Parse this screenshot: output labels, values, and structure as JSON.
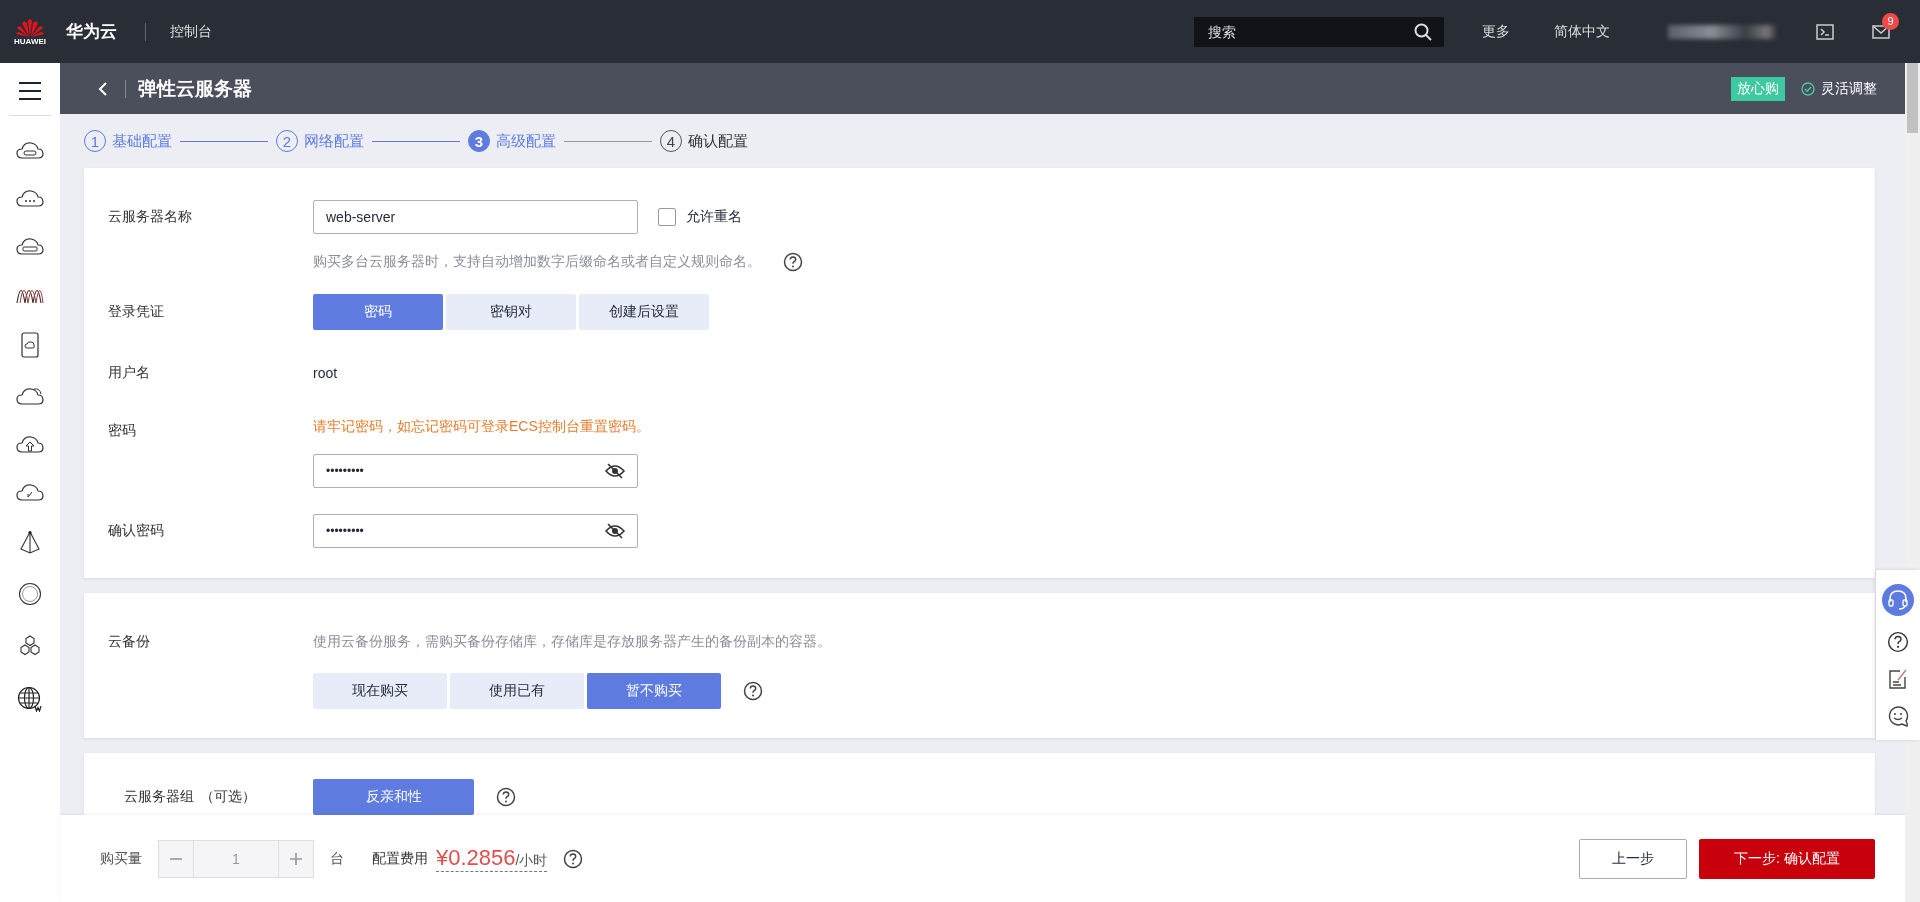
{
  "topbar": {
    "logo_text": "HUAWEI",
    "brand": "华为云",
    "console": "控制台",
    "search": {
      "placeholder": "搜索"
    },
    "links": [
      "更多",
      "简体中文"
    ],
    "notification_count": "9"
  },
  "header": {
    "title": "弹性云服务器",
    "tag": "放心购",
    "adjust": "灵活调整"
  },
  "steps": [
    {
      "number": "1",
      "label": "基础配置",
      "completed": true,
      "selected": false
    },
    {
      "number": "2",
      "label": "网络配置",
      "completed": true,
      "selected": false
    },
    {
      "number": "3",
      "label": "高级配置",
      "completed": false,
      "selected": true
    },
    {
      "number": "4",
      "label": "确认配置",
      "completed": false,
      "selected": false
    }
  ],
  "basic": {
    "name_label": "云服务器名称",
    "name_value": "web-server",
    "allow_duplicate": {
      "label": "允许重名",
      "checked": false
    },
    "name_hint": "购买多台云服务器时，支持自动增加数字后缀命名或者自定义规则命名。",
    "credential_label": "登录凭证",
    "credential_options": [
      {
        "label": "密码",
        "selected": true
      },
      {
        "label": "密钥对",
        "selected": false
      },
      {
        "label": "创建后设置",
        "selected": false
      }
    ],
    "username_label": "用户名",
    "username_value": "root",
    "password_label": "密码",
    "password_warning": "请牢记密码，如忘记密码可登录ECS控制台重置密码。",
    "password_value": "•••••••••",
    "confirm_label": "确认密码",
    "confirm_value": "•••••••••"
  },
  "backup": {
    "label": "云备份",
    "description": "使用云备份服务，需购买备份存储库，存储库是存放服务器产生的备份副本的容器。",
    "options": [
      {
        "label": "现在购买",
        "selected": false
      },
      {
        "label": "使用已有",
        "selected": false
      },
      {
        "label": "暂不购买",
        "selected": true
      }
    ]
  },
  "server_group": {
    "label": "云服务器组",
    "optional": "（可选）",
    "options": [
      {
        "label": "反亲和性",
        "selected": true
      }
    ]
  },
  "footer": {
    "quantity_label": "购买量",
    "quantity": "1",
    "unit": "台",
    "fee_label": "配置费用",
    "price": "¥0.2856",
    "per": "/小时",
    "prev_button": "上一步",
    "next_button": "下一步: 确认配置"
  }
}
